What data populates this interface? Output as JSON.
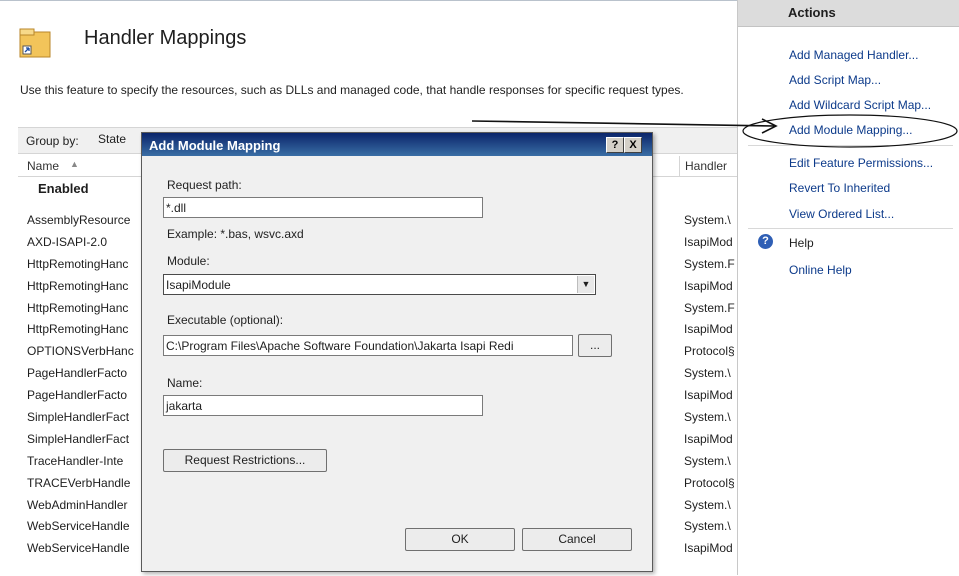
{
  "main": {
    "title": "Handler Mappings",
    "description": "Use this feature to specify the resources, such as DLLs and managed code, that handle responses for specific request types.",
    "group_by_label": "Group by:",
    "group_by_value": "State",
    "columns": {
      "name": "Name",
      "handler": "Handler"
    },
    "group_title": "Enabled",
    "rows": [
      {
        "name": "AssemblyResource",
        "handler": "System.\\"
      },
      {
        "name": "AXD-ISAPI-2.0",
        "handler": "IsapiMod"
      },
      {
        "name": "HttpRemotingHanc",
        "handler": "System.F"
      },
      {
        "name": "HttpRemotingHanc",
        "handler": "IsapiMod"
      },
      {
        "name": "HttpRemotingHanc",
        "handler": "System.F"
      },
      {
        "name": "HttpRemotingHanc",
        "handler": "IsapiMod"
      },
      {
        "name": "OPTIONSVerbHanc",
        "handler": "Protocol§"
      },
      {
        "name": "PageHandlerFacto",
        "handler": "System.\\"
      },
      {
        "name": "PageHandlerFacto",
        "handler": "IsapiMod"
      },
      {
        "name": "SimpleHandlerFact",
        "handler": "System.\\"
      },
      {
        "name": "SimpleHandlerFact",
        "handler": "IsapiMod"
      },
      {
        "name": "TraceHandler-Inte",
        "handler": "System.\\"
      },
      {
        "name": "TRACEVerbHandle",
        "handler": "Protocol§"
      },
      {
        "name": "WebAdminHandler",
        "handler": "System.\\"
      },
      {
        "name": "WebServiceHandle",
        "handler": "System.\\"
      },
      {
        "name": "WebServiceHandle",
        "handler": "IsapiMod"
      }
    ]
  },
  "actions": {
    "header": "Actions",
    "items": [
      "Add Managed Handler...",
      "Add Script Map...",
      "Add Wildcard Script Map...",
      "Add Module Mapping...",
      "Edit Feature Permissions...",
      "Revert To Inherited",
      "View Ordered List..."
    ],
    "help": "Help",
    "online_help": "Online Help"
  },
  "dialog": {
    "title": "Add Module Mapping",
    "help_glyph": "?",
    "close_glyph": "X",
    "request_path_label": "Request path:",
    "request_path_value": "*.dll",
    "request_path_example": "Example: *.bas, wsvc.axd",
    "module_label": "Module:",
    "module_value": "IsapiModule",
    "executable_label": "Executable (optional):",
    "executable_value": "C:\\Program Files\\Apache Software Foundation\\Jakarta Isapi Redi",
    "browse_label": "...",
    "name_label": "Name:",
    "name_value": "jakarta",
    "request_restrictions_label": "Request Restrictions...",
    "ok_label": "OK",
    "cancel_label": "Cancel"
  },
  "icons": {
    "feature": "handler-mappings-icon",
    "help": "help-icon",
    "dropdown": "chevron-down-icon"
  },
  "colors": {
    "title_bar": "#0a246a",
    "link": "#0c3a8a",
    "actions_header": "#dcdcdc"
  }
}
